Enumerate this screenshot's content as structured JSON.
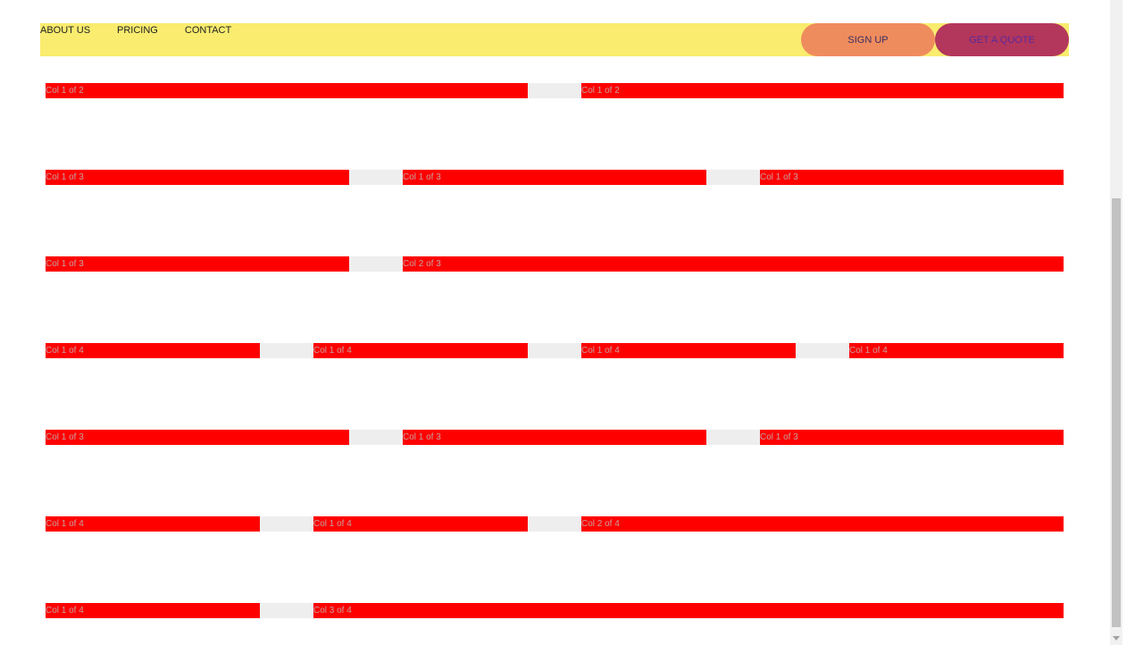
{
  "nav": {
    "links": [
      "ABOUT US",
      "PRICING",
      "CONTACT"
    ],
    "signup_label": "SIGN UP",
    "quote_label": "GET A QUOTE",
    "colors": {
      "bar": "#f9ec6e",
      "signup": "#ef8c5e",
      "quote": "#b3375c"
    }
  },
  "grid": {
    "colors": {
      "column": "#ff0000",
      "gutter": "#eeeeee"
    },
    "rows": [
      [
        "Col 1 of 2",
        "Col 1 of 2"
      ],
      [
        "Col 1 of 3",
        "Col 1 of 3",
        "Col 1 of 3"
      ],
      [
        "Col 1 of 3",
        "Col 2 of 3"
      ],
      [
        "Col 1 of 4",
        "Col 1 of 4",
        "Col 1 of 4",
        "Col 1 of 4"
      ],
      [
        "Col 1 of 3",
        "Col 1 of 3",
        "Col 1 of 3"
      ],
      [
        "Col 1 of 4",
        "Col 1 of 4",
        "Col 2 of 4"
      ],
      [
        "Col 1 of 4",
        "Col 3 of 4"
      ]
    ]
  }
}
